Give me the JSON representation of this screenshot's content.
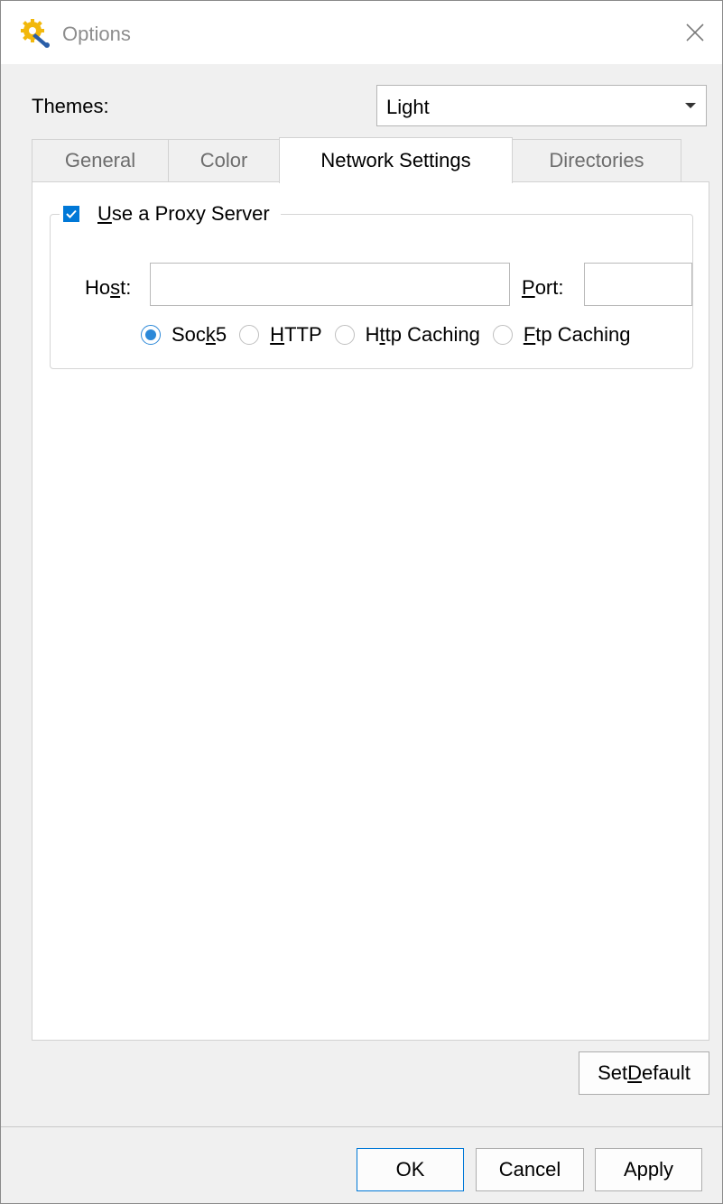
{
  "window": {
    "title": "Options"
  },
  "themes": {
    "label": "Themes:",
    "selected": "Light"
  },
  "tabs": [
    {
      "label": "General",
      "active": false
    },
    {
      "label": "Color",
      "active": false
    },
    {
      "label": "Network Settings",
      "active": true
    },
    {
      "label": "Directories",
      "active": false
    }
  ],
  "proxy": {
    "use_proxy_label_mnemonic": "U",
    "use_proxy_label_rest": "se a Proxy Server",
    "use_proxy_checked": true,
    "host_label_pre": "Ho",
    "host_label_mnemonic": "s",
    "host_label_post": "t:",
    "host_value": "",
    "port_label_mnemonic": "P",
    "port_label_post": "ort:",
    "port_value": "",
    "protocols": [
      {
        "pre": "Soc",
        "mnemonic": "k",
        "post": "5",
        "checked": true
      },
      {
        "pre": "",
        "mnemonic": "H",
        "post": "TTP",
        "checked": false
      },
      {
        "pre": "H",
        "mnemonic": "t",
        "post": "tp Caching",
        "checked": false
      },
      {
        "pre": "",
        "mnemonic": "F",
        "post": "tp Caching",
        "checked": false
      }
    ]
  },
  "buttons": {
    "set_default_pre": "Set ",
    "set_default_mnemonic": "D",
    "set_default_post": "efault",
    "ok": "OK",
    "cancel": "Cancel",
    "apply": "Apply"
  },
  "colors": {
    "accent": "#0078d7",
    "radio_accent": "#2b88d8",
    "icon_gold": "#f2b80c"
  }
}
